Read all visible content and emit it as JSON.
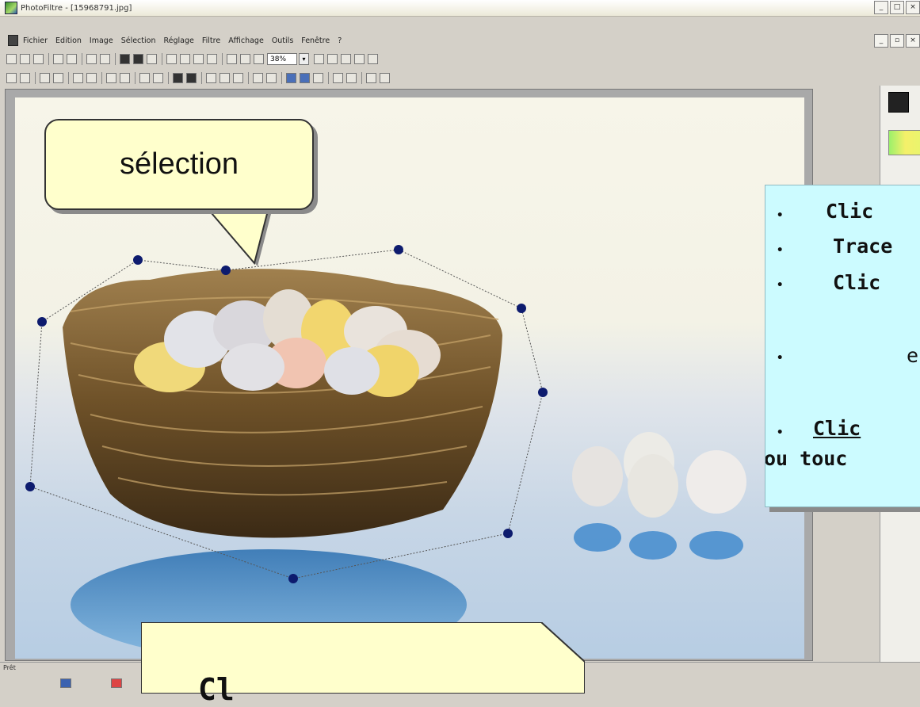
{
  "window": {
    "title": "PhotoFiltre - [15968791.jpg]"
  },
  "menu": {
    "items": [
      "Fichier",
      "Edition",
      "Image",
      "Sélection",
      "Réglage",
      "Filtre",
      "Affichage",
      "Outils",
      "Fenêtre",
      "?"
    ]
  },
  "toolbar": {
    "zoom_value": "38%"
  },
  "status": {
    "text": "Prêt"
  },
  "callouts": {
    "selection_label": "sélection",
    "bottom_label": "Cl"
  },
  "instructions": {
    "line1": "Clic",
    "line2": "Trace",
    "line3": "Clic",
    "line4": "e",
    "line5": "Clic",
    "line6": "ou touc"
  },
  "colors": {
    "callout_bg": "#ffffcc",
    "info_bg": "#ccfbff",
    "selection_handle": "#0d1b6e"
  },
  "icons": {
    "app": "photofiltre-app-icon",
    "minimize": "minimize-icon",
    "maximize": "maximize-icon",
    "close": "close-icon"
  }
}
